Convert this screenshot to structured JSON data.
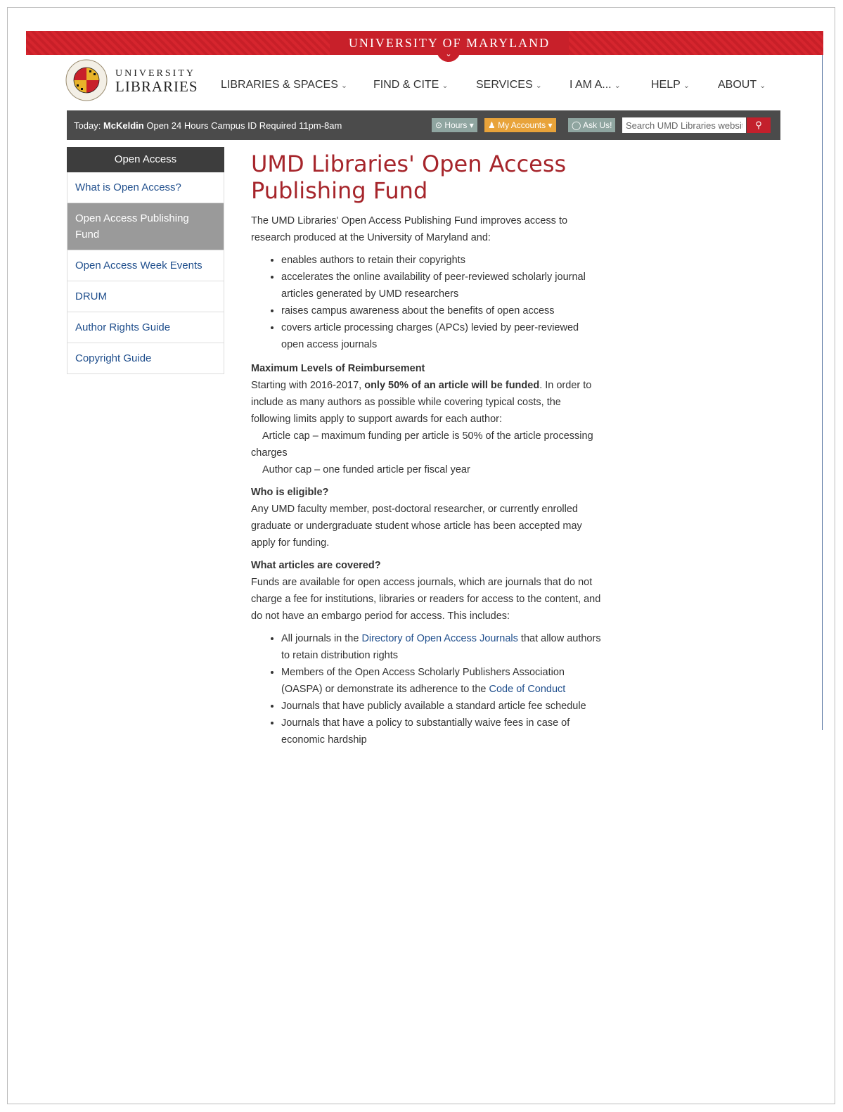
{
  "umd_bar": {
    "title": "UNIVERSITY OF MARYLAND"
  },
  "brand": {
    "line1": "UNIVERSITY",
    "line2": "LIBRARIES",
    "seal_text": "UNIVERSITY OF MARYLAND"
  },
  "nav": [
    {
      "label": "LIBRARIES & SPACES"
    },
    {
      "label": "FIND & CITE"
    },
    {
      "label": "SERVICES"
    },
    {
      "label": "I AM A..."
    },
    {
      "label": "HELP"
    },
    {
      "label": "ABOUT"
    }
  ],
  "statusbar": {
    "today_prefix": "Today:",
    "location": "McKeldin",
    "hours_text": "Open 24 Hours Campus ID Required 11pm-8am",
    "hours_btn": "Hours",
    "accounts_btn": "My Accounts",
    "ask_btn": "Ask Us!",
    "search_placeholder": "Search UMD Libraries website"
  },
  "sidebar": {
    "heading": "Open Access",
    "items": [
      {
        "label": "What is Open Access?"
      },
      {
        "label": "Open Access Publishing Fund"
      },
      {
        "label": "Open Access Week Events"
      },
      {
        "label": "DRUM"
      },
      {
        "label": "Author Rights Guide"
      },
      {
        "label": "Copyright Guide"
      }
    ]
  },
  "content": {
    "title": "UMD Libraries' Open Access Publishing Fund",
    "intro": "The UMD Libraries' Open Access Publishing Fund improves access to research produced at the University of Maryland and:",
    "benefits": [
      "enables authors to retain their copyrights",
      "accelerates the online availability of peer-reviewed scholarly journal articles generated by UMD researchers",
      "raises campus awareness about the benefits of open access",
      "covers article processing charges (APCs) levied by peer-reviewed open access journals"
    ],
    "reimb_heading": "Maximum Levels of Reimbursement",
    "reimb_pre": "Starting with 2016-2017, ",
    "reimb_bold": "only 50% of an article will be funded",
    "reimb_post": ". In order to include as many authors as possible while covering typical costs, the following limits apply to support awards for each author:",
    "article_cap": "Article cap – maximum funding per article is 50% of the article processing charges",
    "author_cap": "Author cap – one funded article per fiscal year",
    "elig_heading": "Who is eligible?",
    "elig_text": "Any UMD faculty member, post-doctoral researcher, or currently enrolled graduate or undergraduate student whose article has been accepted may apply for funding.",
    "covered_heading": "What articles are covered?",
    "covered_text": "Funds are available for open access journals, which are journals that do not charge a fee for institutions, libraries or readers for access to the content, and do not have an embargo period for access. This includes:",
    "c1_pre": "All journals in the ",
    "c1_link": "Directory of Open Access Journals",
    "c1_post": " that allow authors to retain distribution rights",
    "c2_pre": "Members of the Open Access Scholarly Publishers Association (OASPA) or demonstrate its adherence to the ",
    "c2_link": "Code of Conduct",
    "c3": "Journals that have publicly available a standard article fee schedule",
    "c4": "Journals that have a policy to substantially waive fees in case of economic hardship"
  },
  "colors": {
    "umd_red": "#c8202a",
    "title_red": "#a6252b",
    "link_blue": "#1f4e8c",
    "bar_grey": "#4b4b4b",
    "accounts_orange": "#e8a33a"
  }
}
